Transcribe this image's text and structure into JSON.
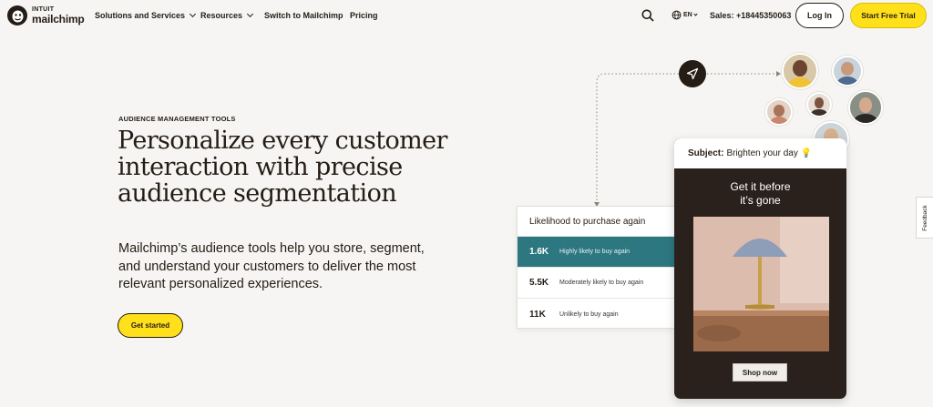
{
  "nav": {
    "brand_top": "INTUIT",
    "brand_bottom": "mailchimp",
    "items": [
      {
        "label": "Solutions and Services"
      },
      {
        "label": "Resources"
      },
      {
        "label": "Switch to Mailchimp"
      },
      {
        "label": "Pricing"
      }
    ],
    "language": "EN",
    "sales": "Sales: +18445350063",
    "login": "Log In",
    "trial": "Start Free Trial"
  },
  "hero": {
    "eyebrow": "AUDIENCE MANAGEMENT TOOLS",
    "headline": "Personalize every customer interaction with precise audience segmentation",
    "subtext": "Mailchimp’s audience tools help you store, segment, and understand your customers to deliver the most relevant personalized experiences.",
    "cta": "Get started"
  },
  "likelihood": {
    "title": "Likelihood to purchase again",
    "rows": [
      {
        "value": "1.6K",
        "label": "Highly likely to buy again"
      },
      {
        "value": "5.5K",
        "label": "Moderately likely to buy again"
      },
      {
        "value": "11K",
        "label": "Unlikely to buy again"
      }
    ],
    "active_color": "#2d7781"
  },
  "email": {
    "subject_label": "Subject:",
    "subject_text": "Brighten your day 💡",
    "headline_1": "Get it before",
    "headline_2": "it’s gone",
    "button": "Shop now"
  },
  "feedback": "Feedback",
  "colors": {
    "accent_yellow": "#ffe01b",
    "ink": "#241c15",
    "teal": "#2d7781",
    "email_bg": "#2b211c"
  }
}
